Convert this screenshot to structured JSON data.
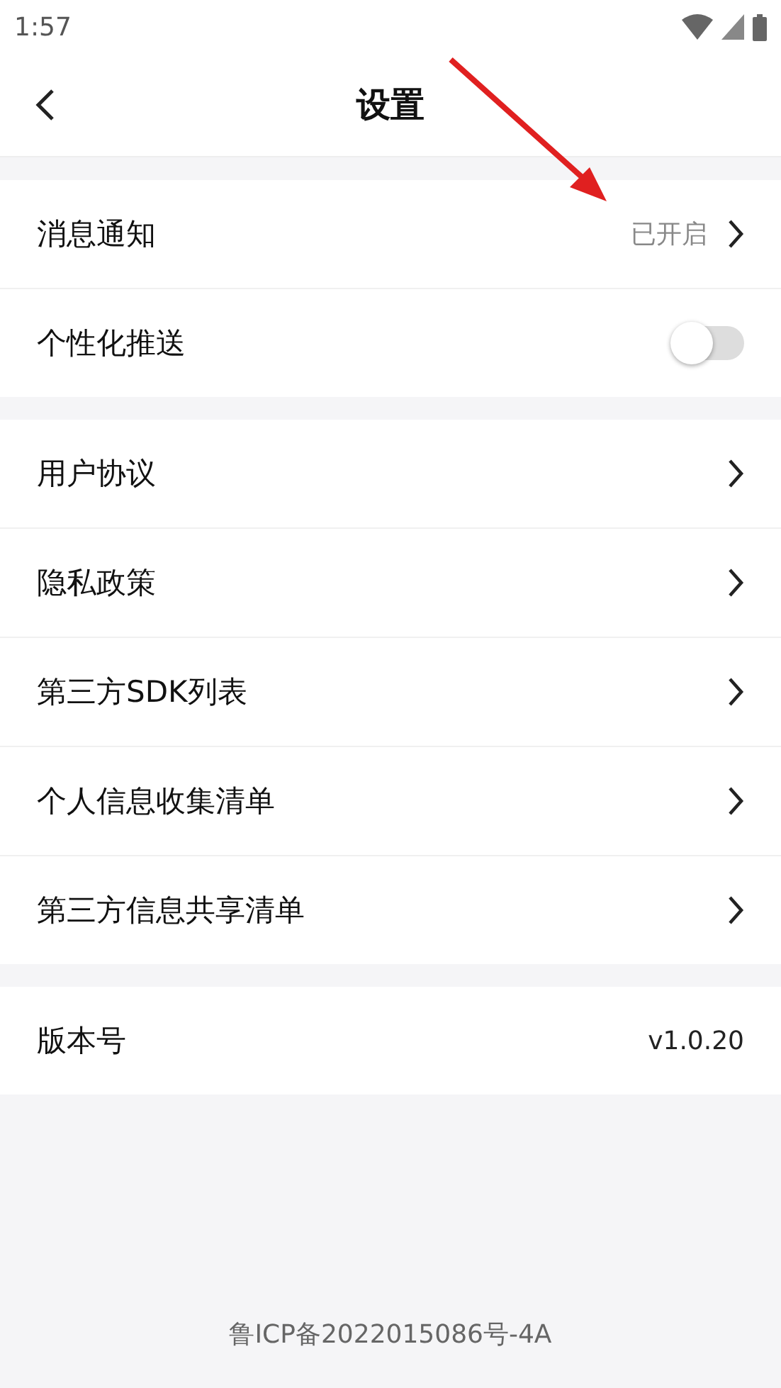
{
  "status_bar": {
    "time": "1:57"
  },
  "header": {
    "title": "设置"
  },
  "sections": [
    [
      {
        "kind": "link",
        "label": "消息通知",
        "value": "已开启"
      },
      {
        "kind": "toggle",
        "label": "个性化推送",
        "on": false
      }
    ],
    [
      {
        "kind": "link",
        "label": "用户协议"
      },
      {
        "kind": "link",
        "label": "隐私政策"
      },
      {
        "kind": "link",
        "label": "第三方SDK列表"
      },
      {
        "kind": "link",
        "label": "个人信息收集清单"
      },
      {
        "kind": "link",
        "label": "第三方信息共享清单"
      }
    ],
    [
      {
        "kind": "info",
        "label": "版本号",
        "value": "v1.0.20"
      }
    ]
  ],
  "footer": "鲁ICP备2022015086号-4A"
}
